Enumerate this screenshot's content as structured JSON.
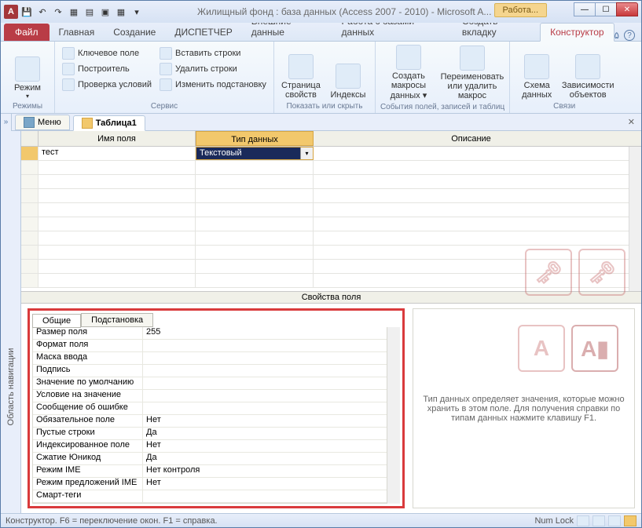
{
  "titlebar": {
    "app_letter": "A",
    "title": "Жилищный фонд : база данных (Access 2007 - 2010)  -  Microsoft A...",
    "context_label": "Работа..."
  },
  "tabs": {
    "file": "Файл",
    "items": [
      "Главная",
      "Создание",
      "ДИСПЕТЧЕР",
      "Внешние данные",
      "Работа с базами данных",
      "Создать вкладку"
    ],
    "active": "Конструктор"
  },
  "ribbon": {
    "mode_big": "Режим",
    "g_modes": "Режимы",
    "tools": {
      "key": "Ключевое поле",
      "builder": "Построитель",
      "test": "Проверка условий",
      "ins": "Вставить строки",
      "del": "Удалить строки",
      "mod": "Изменить подстановку"
    },
    "g_service": "Сервис",
    "props": "Страница свойств",
    "indexes": "Индексы",
    "g_show": "Показать или скрыть",
    "macro_create_1": "Создать макросы",
    "macro_create_2": "данных ▾",
    "macro_del_1": "Переименовать",
    "macro_del_2": "или удалить макрос",
    "g_events": "События полей, записей и таблиц",
    "schema_1": "Схема",
    "schema_2": "данных",
    "deps_1": "Зависимости",
    "deps_2": "объектов",
    "g_links": "Связи"
  },
  "doctabs": {
    "menu": "Меню",
    "table": "Таблица1"
  },
  "nav_label": "Область навигации",
  "grid": {
    "h_name": "Имя поля",
    "h_type": "Тип данных",
    "h_desc": "Описание",
    "row_name": "тест",
    "row_type": "Текстовый"
  },
  "prop_divider": "Свойства поля",
  "proptabs": {
    "general": "Общие",
    "lookup": "Подстановка"
  },
  "props": [
    {
      "k": "Размер поля",
      "v": "255"
    },
    {
      "k": "Формат поля",
      "v": ""
    },
    {
      "k": "Маска ввода",
      "v": ""
    },
    {
      "k": "Подпись",
      "v": ""
    },
    {
      "k": "Значение по умолчанию",
      "v": ""
    },
    {
      "k": "Условие на значение",
      "v": ""
    },
    {
      "k": "Сообщение об ошибке",
      "v": ""
    },
    {
      "k": "Обязательное поле",
      "v": "Нет"
    },
    {
      "k": "Пустые строки",
      "v": "Да"
    },
    {
      "k": "Индексированное поле",
      "v": "Нет"
    },
    {
      "k": "Сжатие Юникод",
      "v": "Да"
    },
    {
      "k": "Режим IME",
      "v": "Нет контроля"
    },
    {
      "k": "Режим предложений IME",
      "v": "Нет"
    },
    {
      "k": "Смарт-теги",
      "v": ""
    }
  ],
  "hint": "Тип данных определяет значения, которые можно хранить в этом поле. Для получения справки по типам данных нажмите клавишу F1.",
  "statusbar": {
    "left": "Конструктор.  F6 = переключение окон.  F1 = справка.",
    "numlock": "Num Lock"
  }
}
